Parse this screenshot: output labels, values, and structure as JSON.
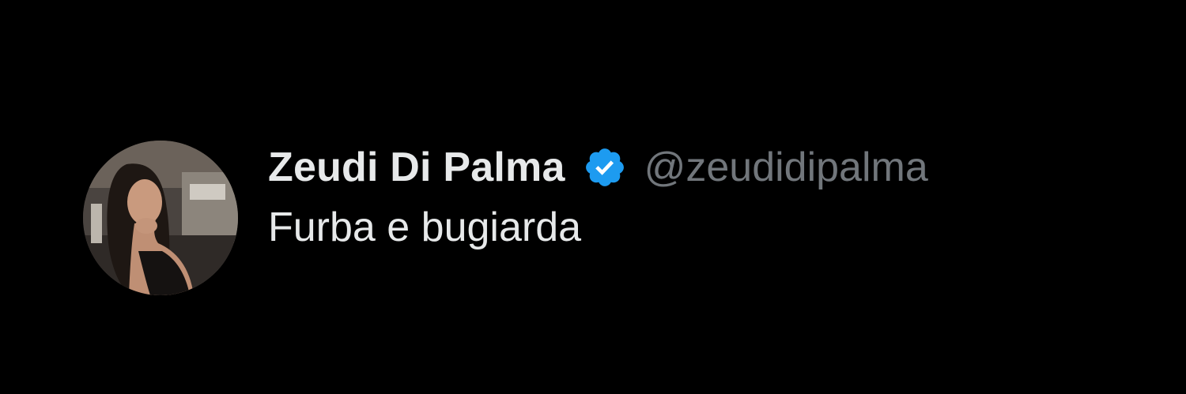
{
  "tweet": {
    "display_name": "Zeudi Di Palma",
    "handle": "@zeudidipalma",
    "text": "Furba e bugiarda",
    "verified_icon": "verified-badge-icon",
    "colors": {
      "background": "#000000",
      "name": "#e7e9ea",
      "handle": "#71767b",
      "verified": "#1d9bf0"
    }
  }
}
